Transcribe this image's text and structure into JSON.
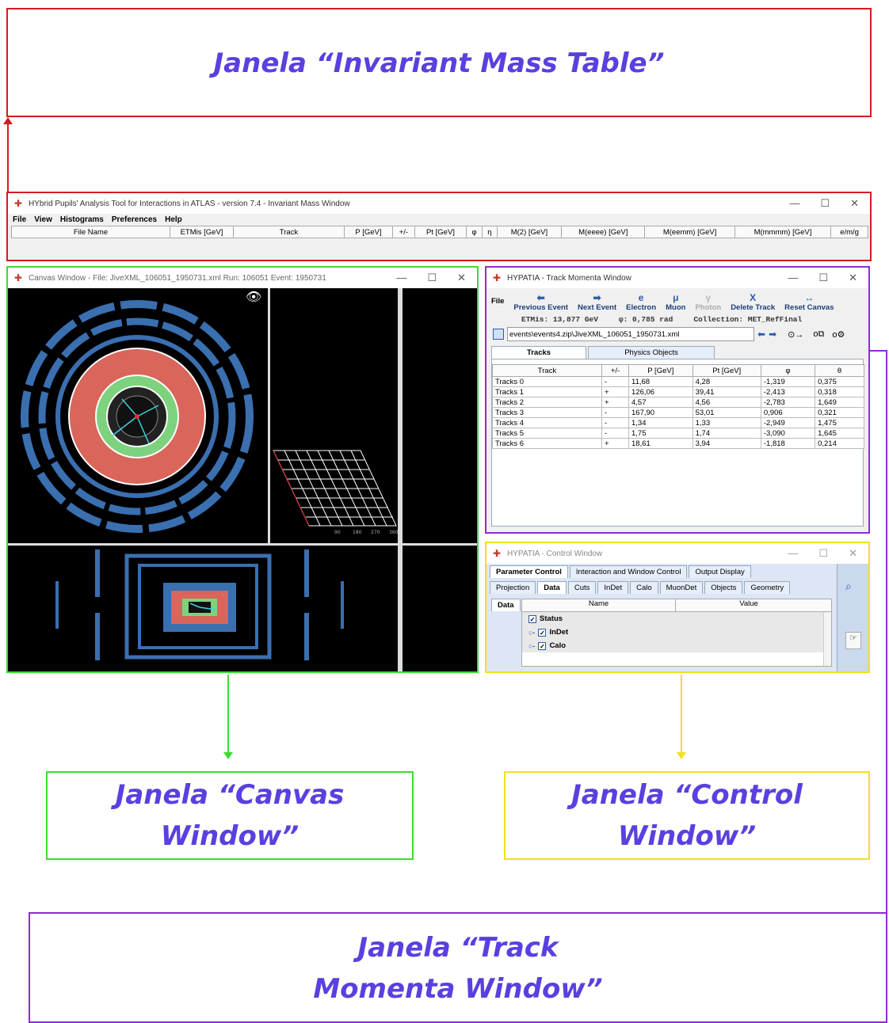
{
  "callouts": {
    "invariant_mass": "Janela “Invariant Mass Table”",
    "canvas": "Janela “Canvas\nWindow”",
    "control": "Janela “Control\nWindow”",
    "track_momenta": "Janela “Track\nMomenta Window”"
  },
  "colors": {
    "red": "#d31c1c",
    "green": "#3ddc2f",
    "yellow": "#f0e020",
    "purple": "#8e2ad6",
    "callout_text": "#5b3fe0"
  },
  "mass_window": {
    "title": "HYbrid Pupils' Analysis Tool for Interactions in ATLAS - version 7.4 - Invariant Mass Window",
    "menu": [
      "File",
      "View",
      "Histograms",
      "Preferences",
      "Help"
    ],
    "columns": [
      "File Name",
      "ETMis [GeV]",
      "Track",
      "P [GeV]",
      "+/-",
      "Pt [GeV]",
      "φ",
      "η",
      "M(2) [GeV]",
      "M(eeee) [GeV]",
      "M(eemm) [GeV]",
      "M(mmmm) [GeV]",
      "e/m/g"
    ]
  },
  "canvas_window": {
    "title": "Canvas Window -  File: JiveXML_106051_1950731.xml  Run: 106051  Event: 1950731",
    "axis_ticks": [
      "90",
      "180",
      "270",
      "360"
    ]
  },
  "track_window": {
    "title": "HYPATIA - Track Momenta Window",
    "file_label": "File",
    "tools": [
      {
        "icon": "arrow-left-icon",
        "glyph": "⬅",
        "label": "Previous Event",
        "enabled": true
      },
      {
        "icon": "arrow-right-icon",
        "glyph": "➡",
        "label": "Next Event",
        "enabled": true
      },
      {
        "icon": "electron-icon",
        "glyph": "e",
        "label": "Electron",
        "enabled": true
      },
      {
        "icon": "muon-icon",
        "glyph": "μ",
        "label": "Muon",
        "enabled": true
      },
      {
        "icon": "photon-icon",
        "glyph": "γ",
        "label": "Photon",
        "enabled": false
      },
      {
        "icon": "delete-icon",
        "glyph": "X",
        "label": "Delete Track",
        "enabled": true
      },
      {
        "icon": "reset-icon",
        "glyph": "↔",
        "label": "Reset Canvas",
        "enabled": true
      }
    ],
    "etmis": "ETMis: 13,877 GeV",
    "phi": "φ: 0,785 rad",
    "collection": "Collection: MET_RefFinal",
    "path": "events\\events4.zip\\JiveXML_106051_1950731.xml",
    "tabs": [
      "Tracks",
      "Physics Objects"
    ],
    "columns": [
      "Track",
      "+/-",
      "P [GeV]",
      "Pt [GeV]",
      "φ",
      "θ"
    ],
    "rows": [
      [
        "Tracks 0",
        "-",
        "11,68",
        "4,28",
        "-1,319",
        "0,375"
      ],
      [
        "Tracks 1",
        "+",
        "126,06",
        "39,41",
        "-2,413",
        "0,318"
      ],
      [
        "Tracks 2",
        "+",
        "4,57",
        "4,56",
        "-2,783",
        "1,649"
      ],
      [
        "Tracks 3",
        "-",
        "167,90",
        "53,01",
        "0,906",
        "0,321"
      ],
      [
        "Tracks 4",
        "-",
        "1,34",
        "1,33",
        "-2,949",
        "1,475"
      ],
      [
        "Tracks 5",
        "-",
        "1,75",
        "1,74",
        "-3,090",
        "1,645"
      ],
      [
        "Tracks 6",
        "+",
        "18,61",
        "3,94",
        "-1,818",
        "0,214"
      ]
    ]
  },
  "control_window": {
    "title": "HYPATIA - Control Window",
    "top_tabs": [
      "Parameter Control",
      "Interaction and Window Control",
      "Output Display"
    ],
    "sub_tabs": [
      "Projection",
      "Data",
      "Cuts",
      "InDet",
      "Calo",
      "MuonDet",
      "Objects",
      "Geometry"
    ],
    "side_tab": "Data",
    "columns": [
      "Name",
      "Value"
    ],
    "items": [
      "Status",
      "InDet",
      "Calo"
    ]
  }
}
